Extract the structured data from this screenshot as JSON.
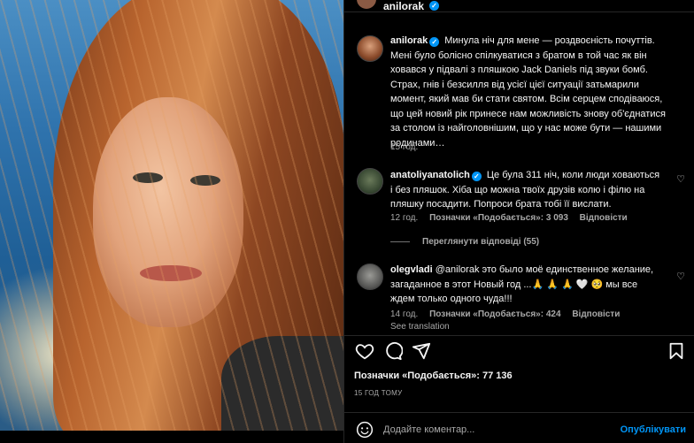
{
  "post": {
    "author": "anilorak",
    "photo_alt": "portrait photo"
  },
  "caption": {
    "user": "anilorak",
    "text": "Минула ніч для мене — роздвоєність почуттів. Мені було болісно спілкуватися з братом в той час як він ховався у підвалі з пляшкою Jack Daniels під звуки бомб. Страх, гнів і безсилля від усієї цієї ситуації затьмарили момент, який мав би стати святом. Всім серцем сподіваюся, що цей новий рік принесе нам можливість знову об'єднатися за столом із найголовнішим, що у нас може бути — нашими родинами…",
    "time": "15 год."
  },
  "comments": [
    {
      "user": "anatoliyanatolich",
      "text": "Це була 311 ніч, коли люди ховаються і без пляшок. Хіба що можна твоїх друзів колю і філю на пляшку посадити. Попроси брата тобі її вислати.",
      "time": "12 год.",
      "likes": "Позначки «Подобається»: 3 093",
      "reply": "Відповісти",
      "view_replies": "Переглянути відповіді (55)"
    },
    {
      "user": "olegvladi",
      "text": "@anilorak это было моё единственное желание, загаданное в этот Новый год ...🙏 🙏 🙏 🤍 🥺 мы все ждем только одного чуда!!!",
      "time": "14 год.",
      "likes": "Позначки «Подобається»: 424",
      "reply": "Відповісти",
      "see_translation": "See translation"
    }
  ],
  "likes_total": "Позначки «Подобається»: 77 136",
  "timestamp": "15 ГОД ТОМУ",
  "composer": {
    "placeholder": "Додайте коментар...",
    "post_label": "Опублікувати"
  },
  "icons": {
    "verified": "verified-badge",
    "like": "heart-icon",
    "comment": "comment-icon",
    "share": "share-icon",
    "save": "bookmark-icon",
    "emoji": "emoji-icon"
  },
  "colors": {
    "accent": "#0095f6",
    "background": "#000000",
    "secondary_text": "#a8a8a8"
  }
}
